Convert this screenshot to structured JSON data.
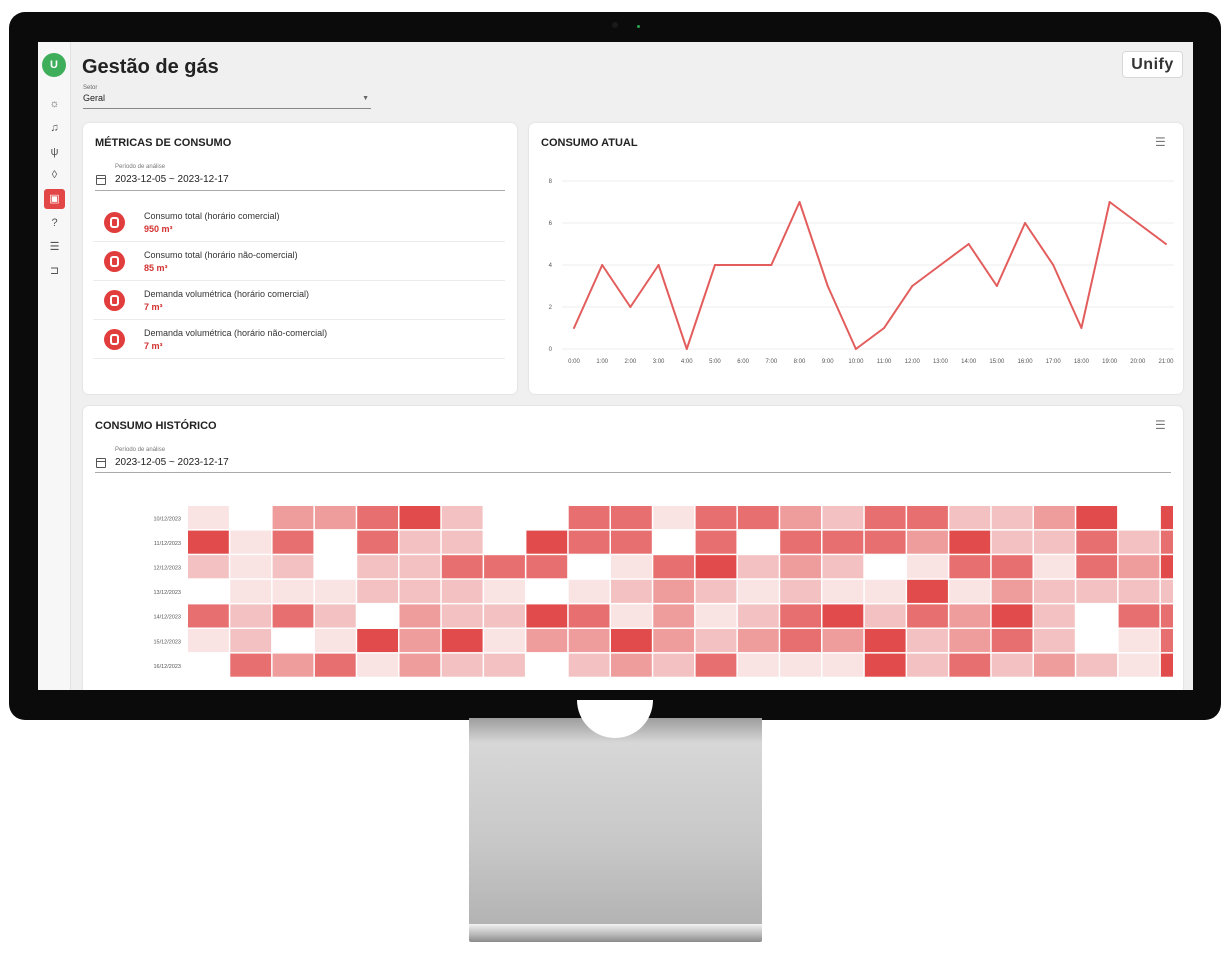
{
  "app": {
    "avatar_initial": "U",
    "title": "Gestão de gás",
    "logo": "Unify",
    "setor": {
      "label": "Setor",
      "value": "Geral"
    }
  },
  "sidebar": {
    "items": [
      {
        "icon": "bulb-icon",
        "glyph": "☼"
      },
      {
        "icon": "bell-icon",
        "glyph": "♫"
      },
      {
        "icon": "plug-icon",
        "glyph": "ψ"
      },
      {
        "icon": "drop-icon",
        "glyph": "◊"
      },
      {
        "icon": "gas-cylinder-icon",
        "glyph": "▣",
        "active": true
      },
      {
        "icon": "help-icon",
        "glyph": "?"
      },
      {
        "icon": "list-icon",
        "glyph": "☰"
      },
      {
        "icon": "logout-icon",
        "glyph": "⊐"
      }
    ]
  },
  "metrics_card": {
    "title": "MÉTRICAS DE CONSUMO",
    "period_label": "Período de análise",
    "period_value": "2023-12-05 ~ 2023-12-17",
    "items": [
      {
        "label": "Consumo total (horário comercial)",
        "value": "950 m³"
      },
      {
        "label": "Consumo total (horário não-comercial)",
        "value": "85 m³"
      },
      {
        "label": "Demanda volumétrica (horário comercial)",
        "value": "7 m³"
      },
      {
        "label": "Demanda volumétrica (horário não-comercial)",
        "value": "7 m³"
      }
    ]
  },
  "current_card": {
    "title": "CONSUMO ATUAL"
  },
  "history_card": {
    "title": "CONSUMO HISTÓRICO",
    "period_label": "Período de análise",
    "period_value": "2023-12-05 ~ 2023-12-17"
  },
  "colors": {
    "accent": "#e34646",
    "line": "#e35d5d",
    "avatar": "#3fae5a"
  },
  "chart_data": [
    {
      "type": "line",
      "x": [
        "0:00",
        "1:00",
        "2:00",
        "3:00",
        "4:00",
        "5:00",
        "6:00",
        "7:00",
        "8:00",
        "9:00",
        "10:00",
        "11:00",
        "12:00",
        "13:00",
        "14:00",
        "15:00",
        "16:00",
        "17:00",
        "18:00",
        "19:00",
        "20:00",
        "21:00"
      ],
      "series": [
        {
          "values": [
            1,
            4,
            2,
            4,
            0,
            4,
            4,
            4,
            7,
            3,
            0,
            1,
            3,
            4,
            5,
            3,
            6,
            4,
            1,
            7,
            6,
            5
          ]
        }
      ],
      "yticks": [
        0,
        2,
        4,
        6,
        8
      ],
      "ylim": [
        0,
        8
      ],
      "grid": true
    },
    {
      "type": "heatmap",
      "rows": [
        "10/12/2023",
        "11/12/2023",
        "12/12/2023",
        "13/12/2023",
        "14/12/2023",
        "15/12/2023",
        "16/12/2023"
      ],
      "columns": 24,
      "values": [
        [
          1,
          0,
          3,
          3,
          4,
          5,
          2,
          0,
          0,
          4,
          4,
          1,
          4,
          4,
          3,
          2,
          4,
          4,
          2,
          2,
          3,
          5,
          0,
          5
        ],
        [
          5,
          1,
          4,
          0,
          4,
          2,
          2,
          0,
          5,
          4,
          4,
          0,
          4,
          0,
          4,
          4,
          4,
          3,
          5,
          2,
          2,
          4,
          2,
          4
        ],
        [
          2,
          1,
          2,
          0,
          2,
          2,
          4,
          4,
          4,
          0,
          1,
          4,
          5,
          2,
          3,
          2,
          0,
          1,
          4,
          4,
          1,
          4,
          3,
          5
        ],
        [
          0,
          1,
          1,
          1,
          2,
          2,
          2,
          1,
          0,
          1,
          2,
          3,
          2,
          1,
          2,
          1,
          1,
          5,
          1,
          3,
          2,
          2,
          2,
          2
        ],
        [
          4,
          2,
          4,
          2,
          0,
          3,
          2,
          2,
          5,
          4,
          1,
          3,
          1,
          2,
          4,
          5,
          2,
          4,
          3,
          5,
          2,
          0,
          4,
          4
        ],
        [
          1,
          2,
          0,
          1,
          5,
          3,
          5,
          1,
          3,
          3,
          5,
          3,
          2,
          3,
          4,
          3,
          5,
          2,
          3,
          4,
          2,
          0,
          1,
          4
        ],
        [
          0,
          4,
          3,
          4,
          1,
          3,
          2,
          2,
          0,
          2,
          3,
          2,
          4,
          1,
          1,
          1,
          5,
          2,
          4,
          2,
          3,
          2,
          1,
          5
        ]
      ]
    }
  ]
}
